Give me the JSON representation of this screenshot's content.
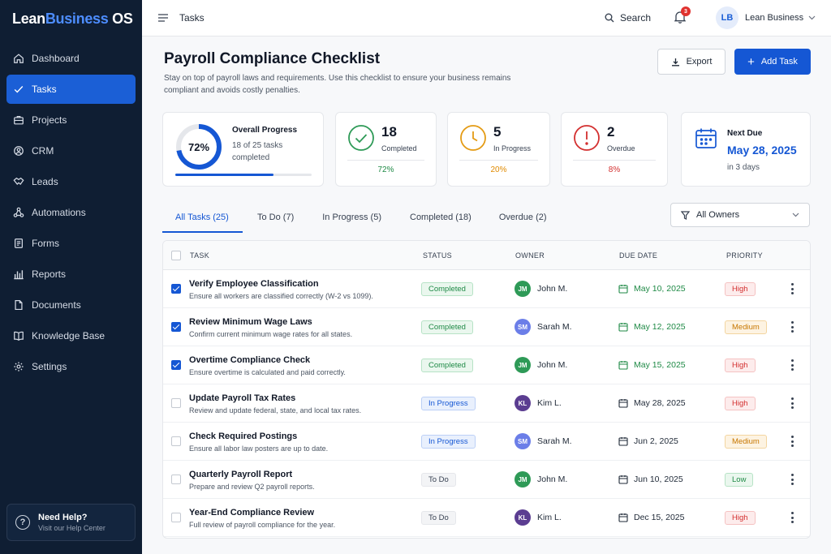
{
  "brand": {
    "part1": "Lean",
    "part2": "Business",
    "part3": " OS"
  },
  "sidebar": {
    "items": [
      {
        "label": "Dashboard",
        "icon": "home-icon"
      },
      {
        "label": "Tasks",
        "icon": "check-icon",
        "active": true
      },
      {
        "label": "Projects",
        "icon": "briefcase-icon"
      },
      {
        "label": "CRM",
        "icon": "user-circle-icon"
      },
      {
        "label": "Leads",
        "icon": "handshake-icon"
      },
      {
        "label": "Automations",
        "icon": "nodes-icon"
      },
      {
        "label": "Forms",
        "icon": "form-icon"
      },
      {
        "label": "Reports",
        "icon": "bar-chart-icon"
      },
      {
        "label": "Documents",
        "icon": "document-icon"
      },
      {
        "label": "Knowledge Base",
        "icon": "book-icon"
      },
      {
        "label": "Settings",
        "icon": "gear-icon"
      }
    ],
    "help": {
      "title": "Need Help?",
      "subtitle": "Visit our Help Center"
    }
  },
  "topbar": {
    "breadcrumb": "Tasks",
    "search_label": "Search",
    "notification_count": "3",
    "user_initials": "LB",
    "user_name": "Lean Business"
  },
  "header": {
    "title": "Payroll Compliance Checklist",
    "subtitle": "Stay on top of payroll laws and requirements. Use this checklist to ensure your business remains compliant and avoids costly penalties.",
    "export_label": "Export",
    "add_label": "Add Task"
  },
  "stats": {
    "overall": {
      "percent_label": "72%",
      "progress": 0.72,
      "title": "Overall Progress",
      "subtitle": "18 of 25 tasks completed"
    },
    "completed": {
      "count": "18",
      "label": "Completed",
      "pct": "72%"
    },
    "in_progress": {
      "count": "5",
      "label": "In Progress",
      "pct": "20%"
    },
    "overdue": {
      "count": "2",
      "label": "Overdue",
      "pct": "8%"
    },
    "next_due": {
      "label": "Next Due",
      "date": "May 28, 2025",
      "subtitle": "in 3 days"
    }
  },
  "colors": {
    "accent": "#1557d4",
    "green": "#1f8a46",
    "orange": "#e49b14",
    "red": "#d32f2f"
  },
  "tabs": [
    {
      "label": "All Tasks (25)",
      "active": true
    },
    {
      "label": "To Do (7)"
    },
    {
      "label": "In Progress (5)"
    },
    {
      "label": "Completed (18)"
    },
    {
      "label": "Overdue (2)"
    }
  ],
  "owners_filter": "All Owners",
  "table": {
    "columns": [
      "TASK",
      "STATUS",
      "OWNER",
      "DUE DATE",
      "PRIORITY"
    ],
    "rows": [
      {
        "checked": true,
        "title": "Verify Employee Classification",
        "desc": "Ensure all workers are classified correctly (W-2 vs 1099).",
        "status": "Completed",
        "owner_initials": "JM",
        "owner": "John M.",
        "owner_color": "#2e9a57",
        "due": "May 10, 2025",
        "due_color": "#1f8a46",
        "priority": "High"
      },
      {
        "checked": true,
        "title": "Review Minimum Wage Laws",
        "desc": "Confirm current minimum wage rates for all states.",
        "status": "Completed",
        "owner_initials": "SM",
        "owner": "Sarah M.",
        "owner_color": "#6b7ee8",
        "due": "May 12, 2025",
        "due_color": "#1f8a46",
        "priority": "Medium"
      },
      {
        "checked": true,
        "title": "Overtime Compliance Check",
        "desc": "Ensure overtime is calculated and paid correctly.",
        "status": "Completed",
        "owner_initials": "JM",
        "owner": "John M.",
        "owner_color": "#2e9a57",
        "due": "May 15, 2025",
        "due_color": "#1f8a46",
        "priority": "High"
      },
      {
        "checked": false,
        "title": "Update Payroll Tax Rates",
        "desc": "Review and update federal, state, and local tax rates.",
        "status": "In Progress",
        "owner_initials": "KL",
        "owner": "Kim L.",
        "owner_color": "#5b3d91",
        "due": "May 28, 2025",
        "due_color": "#1f2937",
        "priority": "High"
      },
      {
        "checked": false,
        "title": "Check Required Postings",
        "desc": "Ensure all labor law posters are up to date.",
        "status": "In Progress",
        "owner_initials": "SM",
        "owner": "Sarah M.",
        "owner_color": "#6b7ee8",
        "due": "Jun 2, 2025",
        "due_color": "#1f2937",
        "priority": "Medium"
      },
      {
        "checked": false,
        "title": "Quarterly Payroll Report",
        "desc": "Prepare and review Q2 payroll reports.",
        "status": "To Do",
        "owner_initials": "JM",
        "owner": "John M.",
        "owner_color": "#2e9a57",
        "due": "Jun 10, 2025",
        "due_color": "#1f2937",
        "priority": "Low"
      },
      {
        "checked": false,
        "title": "Year-End Compliance Review",
        "desc": "Full review of payroll compliance for the year.",
        "status": "To Do",
        "owner_initials": "KL",
        "owner": "Kim L.",
        "owner_color": "#5b3d91",
        "due": "Dec 15, 2025",
        "due_color": "#1f2937",
        "priority": "High"
      }
    ]
  }
}
